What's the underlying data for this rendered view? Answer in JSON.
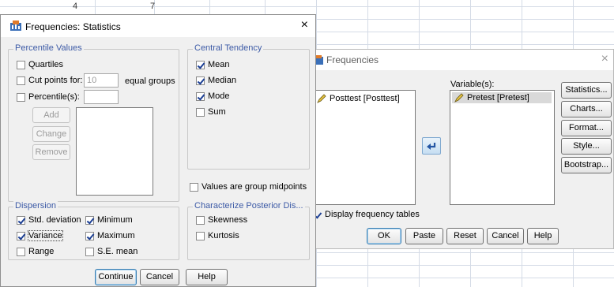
{
  "sheet": {
    "cell_values": [
      "4",
      "7"
    ]
  },
  "frequencies": {
    "title": "Frequencies",
    "source_list": [
      "Posttest [Posttest]"
    ],
    "variables_label": "Variable(s):",
    "variables_list": [
      "Pretest [Pretest]"
    ],
    "display_tables_label": "Display frequency tables",
    "display_tables_checked": true,
    "side_buttons": [
      "Statistics...",
      "Charts...",
      "Format...",
      "Style...",
      "Bootstrap..."
    ],
    "bottom_buttons": [
      "OK",
      "Paste",
      "Reset",
      "Cancel",
      "Help"
    ]
  },
  "statistics": {
    "title": "Frequencies: Statistics",
    "percentile": {
      "label": "Percentile Values",
      "quartiles": "Quartiles",
      "cut_points": "Cut points for:",
      "cut_points_value": "10",
      "equal_groups": "equal groups",
      "percentiles": "Percentile(s):",
      "add": "Add",
      "change": "Change",
      "remove": "Remove"
    },
    "central": {
      "label": "Central Tendency",
      "mean": "Mean",
      "median": "Median",
      "mode": "Mode",
      "sum": "Sum"
    },
    "group_midpoints": "Values are group midpoints",
    "dispersion": {
      "label": "Dispersion",
      "std_dev": "Std. deviation",
      "minimum": "Minimum",
      "variance": "Variance",
      "maximum": "Maximum",
      "range": "Range",
      "se_mean": "S.E. mean"
    },
    "posterior": {
      "label": "Characterize Posterior Dis...",
      "skewness": "Skewness",
      "kurtosis": "Kurtosis"
    },
    "buttons": {
      "continue": "Continue",
      "cancel": "Cancel",
      "help": "Help"
    },
    "close": "×"
  },
  "colors": {
    "accent": "#3c5aa6",
    "check": "#1c3f94",
    "dialog_bg": "#f0f0f0"
  }
}
